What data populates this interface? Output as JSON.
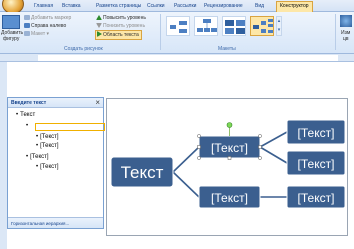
{
  "ribbon": {
    "tabs": [
      "Главная",
      "Вставка",
      "Разметка страницы",
      "Ссылки",
      "Рассылки",
      "Рецензирование",
      "Вид",
      "Конструктор"
    ],
    "active_tab": "Конструктор",
    "create_group": {
      "add_shape_label_line1": "Добавить",
      "add_shape_label_line2": "фигуру",
      "add_bullet_label": "Добавить маркер",
      "right_to_left_label": "Справа налево",
      "layout_label": "Макет",
      "promote_label": "Повысить уровень",
      "demote_label": "Понизить уровень",
      "text_pane_label": "Область текста",
      "group_label": "Создать рисунок"
    },
    "layouts_group": {
      "group_label": "Макеты"
    },
    "right_cut_label_line1": "Изм",
    "right_cut_label_line2": "цв"
  },
  "text_pane": {
    "title": "Введите текст",
    "close_glyph": "×",
    "items": [
      {
        "text": "Текст"
      },
      {
        "text": ""
      },
      {
        "text": "[Текст]"
      },
      {
        "text": "[Текст]"
      },
      {
        "text": "[Текст]"
      },
      {
        "text": "[Текст]"
      }
    ],
    "footer_label": "Горизонтальная иерархия..."
  },
  "diagram": {
    "root": "Текст",
    "level1": [
      "[Текст]",
      "[Текст]"
    ],
    "level2": [
      "[Текст]",
      "[Текст]",
      "[Текст]"
    ],
    "box_color": "#3b5f8f",
    "line_color": "#3b5f8f"
  },
  "colors": {
    "accent": "#4c7fc2",
    "highlight": "#fde7a8",
    "ribbon_bg": "#d7e6f8"
  }
}
